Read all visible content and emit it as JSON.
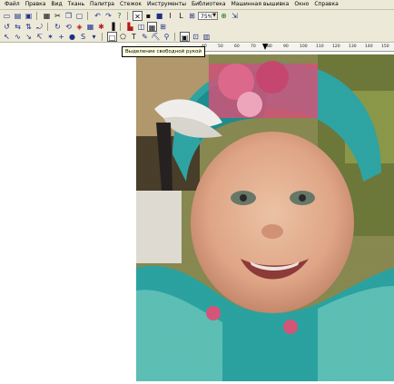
{
  "menu": [
    "Файл",
    "Правка",
    "Вид",
    "Ткань",
    "Палитра",
    "Стежок",
    "Инструменты",
    "Библиотека",
    "Машинная вышивка",
    "Окно",
    "Справка"
  ],
  "toolbar": {
    "row1": [
      "new-icon",
      "open-icon",
      "save-icon",
      "print-icon",
      "cut-icon",
      "copy-icon",
      "paste-icon",
      "undo-icon",
      "redo-icon",
      "help-icon",
      "sep",
      "select-icon",
      "fill-icon",
      "stitch-icon",
      "line-icon",
      "text-icon",
      "zoom-icon"
    ],
    "zoom_value": "75%",
    "row2": [
      "rotate-icon",
      "mirror-icon",
      "flip-icon",
      "wrap-icon",
      "refresh-icon",
      "palette-icon",
      "color-icon",
      "grid-icon",
      "stitch-type-icon",
      "sep",
      "table-icon",
      "grid-toggle-icon"
    ],
    "row3": [
      "pointer-icon",
      "freehand-icon",
      "arrow-icon",
      "lasso-icon",
      "star-icon",
      "dot-icon",
      "brush-icon",
      "s-icon",
      "sep",
      "rect-icon",
      "polygon-icon",
      "text-tool-icon",
      "eyedropper-icon",
      "paint-icon",
      "magnify-icon",
      "sep",
      "frame-icon",
      "layer-icon",
      "grid2-icon"
    ]
  },
  "tooltip": "Выделение свободной рукой",
  "ruler": {
    "ticks": [
      "40",
      "50",
      "60",
      "70",
      "80",
      "90",
      "100",
      "110",
      "120",
      "130",
      "140",
      "150"
    ]
  },
  "image": {
    "description_icons": [
      "baby-photo"
    ]
  },
  "colors": {
    "chrome": "#ece9d8",
    "tooltip_bg": "#ffffe1",
    "accent": "#1c2f8a"
  }
}
